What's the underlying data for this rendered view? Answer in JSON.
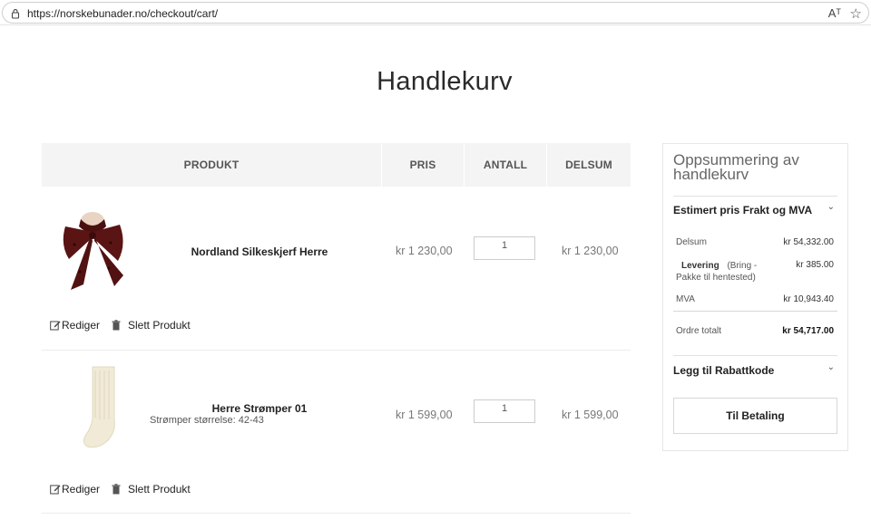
{
  "browser": {
    "url": "https://norskebunader.no/checkout/cart/",
    "read_aloud": "Aᵀ",
    "favorite": "☆"
  },
  "page": {
    "title": "Handlekurv"
  },
  "table": {
    "headers": {
      "product": "PRODUKT",
      "price": "PRIS",
      "qty": "ANTALL",
      "subtotal": "DELSUM"
    }
  },
  "items": [
    {
      "name": "Nordland Silkeskjerf Herre",
      "option": "",
      "price": "kr 1 230,00",
      "qty": "1",
      "subtotal": "kr 1 230,00",
      "edit_label": "Rediger",
      "delete_label": "Slett Produkt",
      "image": "silk-scarf"
    },
    {
      "name": "Herre Strømper 01",
      "option": "Strømper størrelse: 42-43",
      "price": "kr 1 599,00",
      "qty": "1",
      "subtotal": "kr 1 599,00",
      "edit_label": "Rediger",
      "delete_label": "Slett Produkt",
      "image": "wool-sock"
    }
  ],
  "summary": {
    "title": "Oppsummering av handlekurv",
    "shipping_heading": "Estimert pris Frakt og MVA",
    "subtotal_label": "Delsum",
    "subtotal_value": "kr 54,332.00",
    "delivery_label_bold": "Levering",
    "delivery_label_rest": "(Bring - Pakke til hentested)",
    "delivery_value": "kr 385.00",
    "vat_label": "MVA",
    "vat_value": "kr 10,943.40",
    "total_label": "Ordre totalt",
    "total_value": "kr 54,717.00",
    "discount_heading": "Legg til Rabattkode",
    "checkout_button": "Til Betaling"
  },
  "colors": {
    "header_bg": "#f4f4f4",
    "scarf": "#5a1414",
    "sock": "#f1ead7"
  }
}
